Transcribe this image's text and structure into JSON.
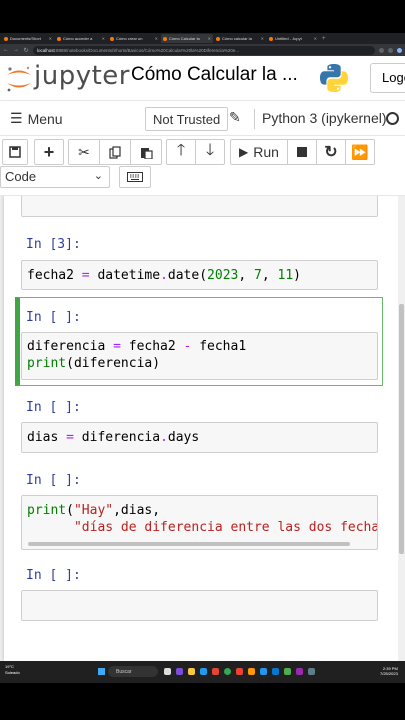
{
  "browser": {
    "tabs": [
      {
        "label": "Documents/Short",
        "active": false
      },
      {
        "label": "Cómo acceder a",
        "active": false
      },
      {
        "label": "Cómo crear un",
        "active": false
      },
      {
        "label": "Cómo Calcular la",
        "active": true
      },
      {
        "label": "Cómo calcular la",
        "active": false
      },
      {
        "label": "Untitled - Jupyt",
        "active": false
      }
    ],
    "url_host": "localhost",
    "url_path": ":8888/notebooks/Documents/Shorts/Basicos/Cómo%20Calcular%20la%20Diferencia%20e..."
  },
  "header": {
    "logo_text": "jupyter",
    "notebook_title": "Cómo Calcular la ...",
    "logout_label": "Logo"
  },
  "menubar": {
    "menu_label": "Menu",
    "trust_label": "Not Trusted",
    "kernel_label": "Python 3 (ipykernel)"
  },
  "toolbar": {
    "run_label": "Run",
    "cell_type": "Code"
  },
  "cells": [
    {
      "prompt": "In [3]:",
      "code": "fecha2 = datetime.date(2023, 7, 11)"
    },
    {
      "prompt": "In [ ]:",
      "line1": "diferencia = fecha2 - fecha1",
      "line2": "print(diferencia)"
    },
    {
      "prompt": "In [ ]:",
      "code": "dias = diferencia.days"
    },
    {
      "prompt": "In [ ]:",
      "line1": "print(\"Hay\",dias,",
      "line2": "      \"días de diferencia entre las dos fechas\")"
    },
    {
      "prompt": "In [ ]:"
    }
  ],
  "taskbar": {
    "weather_temp": "19°C",
    "weather_desc": "Soleado",
    "search_label": "Buscar",
    "time": "2:39 PM",
    "date": "7/25/2023"
  },
  "colors": {
    "selected_cell_border": "#42a545",
    "prompt_color": "#303f9f",
    "keyword_green": "#008000",
    "string_red": "#ba2121",
    "operator_purple": "#aa22ff"
  }
}
